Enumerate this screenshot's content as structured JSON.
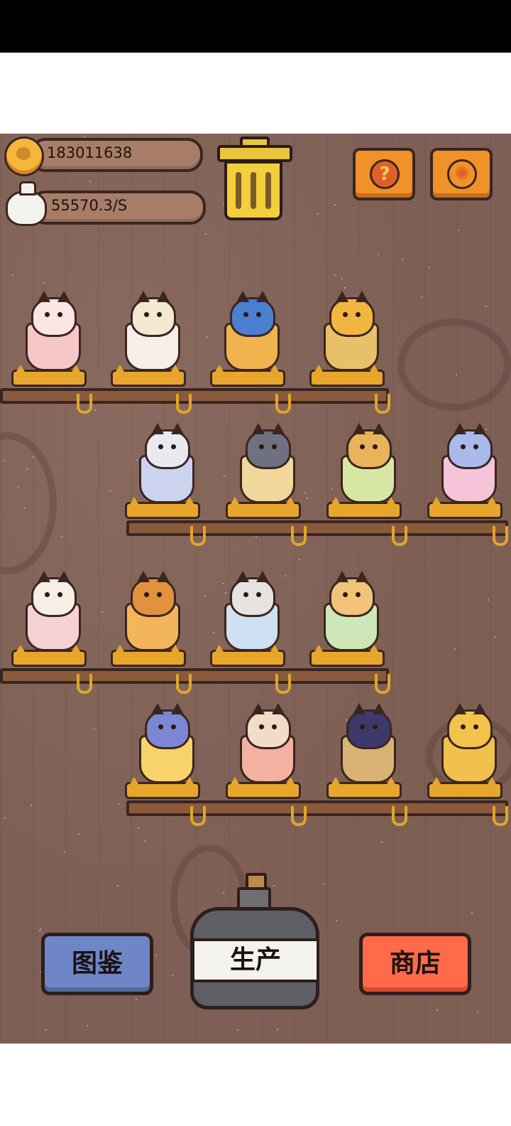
{
  "resources": {
    "coins": "183011638",
    "income_rate": "55570.3/S"
  },
  "buttons": {
    "help_glyph": "?",
    "settings_glyph": "✺",
    "collection_label": "图鉴",
    "produce_label": "生产",
    "shop_label": "商店"
  },
  "icons": {
    "coin": "coin-icon",
    "money_bag": "money-bag-icon",
    "trash": "trash-can-icon",
    "help": "help-icon",
    "settings": "settings-icon"
  },
  "shelves": [
    {
      "row": 1,
      "cats": [
        "cat-in-bowl",
        "calico-cat-in-cup",
        "blue-cat-in-mug",
        "orange-cat-in-glass"
      ]
    },
    {
      "row": 2,
      "cats": [
        "white-cat-in-bowl",
        "twin-cats-in-beer",
        "cat-in-sundae-glass",
        "blue-cat-in-parfait"
      ]
    },
    {
      "row": 3,
      "cats": [
        "cat-with-guitar-in-glass",
        "cat-in-orange-glass",
        "siamese-cat-in-cup",
        "cat-in-teacup"
      ]
    },
    {
      "row": 4,
      "cats": [
        "wizard-cat-in-beer",
        "cat-in-peach-glass",
        "black-cat-in-glass",
        "cat-on-plate"
      ]
    }
  ],
  "colors": {
    "wood_bg": "#7d5f55",
    "coin": "#f5b73b",
    "orange_button": "#f0912a",
    "collection_button": "#6f86c6",
    "shop_button": "#ff6a4a",
    "bottle": "#5f6066"
  }
}
